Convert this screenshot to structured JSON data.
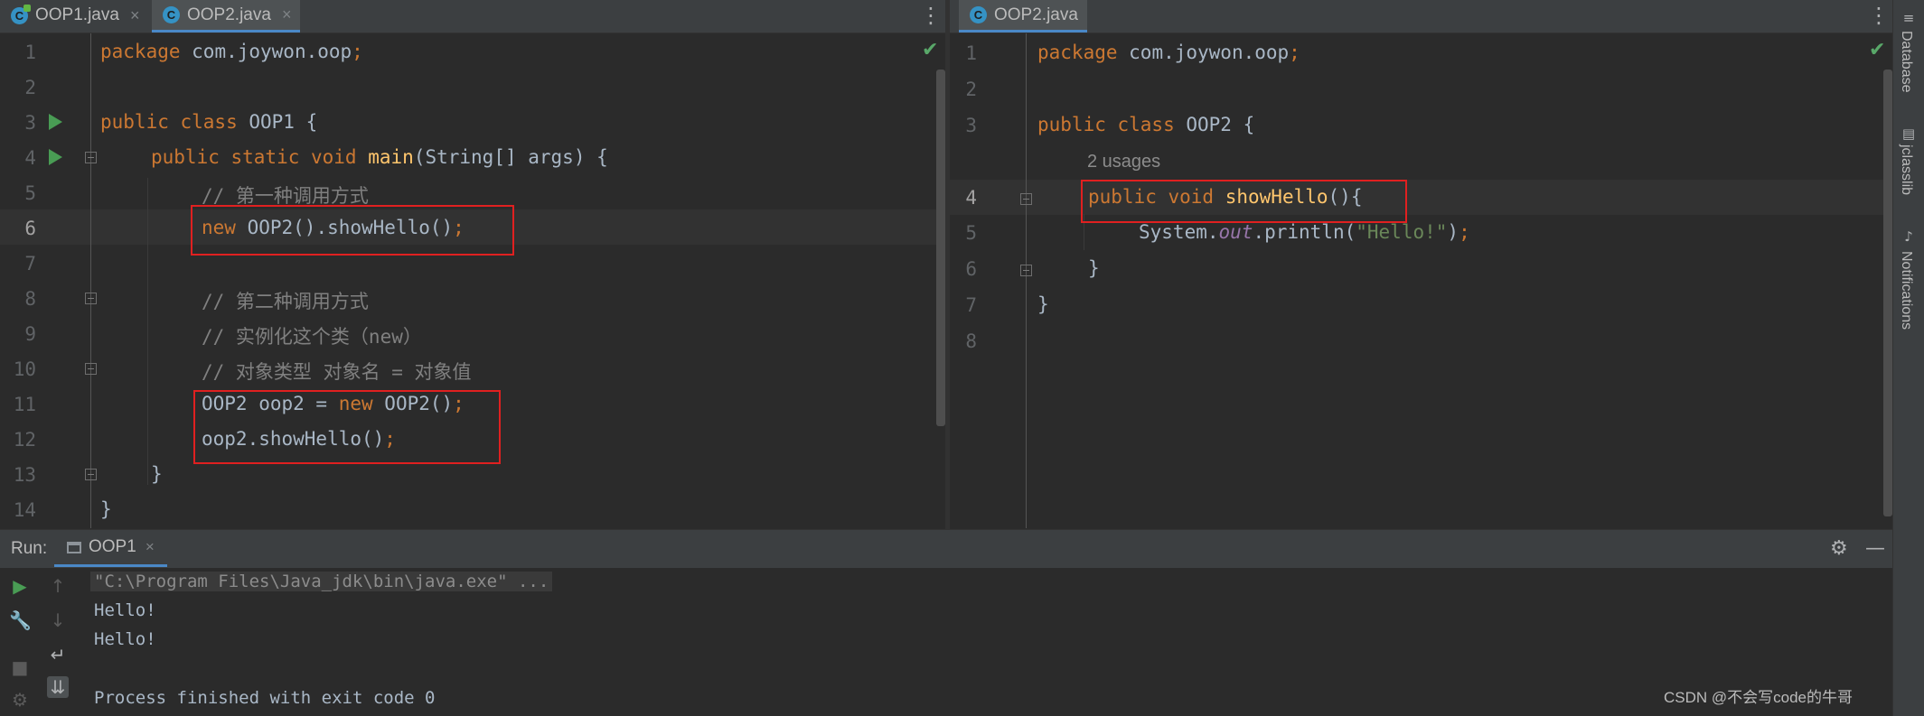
{
  "left_tabs": [
    {
      "label": "OOP1.java",
      "close": "×"
    },
    {
      "label": "OOP2.java",
      "close": "×"
    }
  ],
  "right_tabs": [
    {
      "label": "OOP2.java"
    }
  ],
  "icons": {
    "class_icon_letter": "C",
    "kebab": "⋮",
    "check": "✔",
    "gear": "⚙",
    "minimize": "—",
    "run": "▶",
    "wrench": "🔧",
    "up": "↑",
    "down": "↓",
    "wrap": "↵",
    "stop": "■",
    "scroll": "⇊"
  },
  "left_editor": {
    "line_numbers": [
      "1",
      "2",
      "3",
      "4",
      "5",
      "6",
      "7",
      "8",
      "9",
      "10",
      "11",
      "12",
      "13",
      "14"
    ],
    "lines": {
      "l1_a": "package",
      "l1_b": " com.joywon.oop",
      "l1_c": ";",
      "l3_a": "public class",
      "l3_b": " OOP1 {",
      "l4_a": "public static void",
      "l4_b": "main",
      "l4_c": "(String[] args) {",
      "l5": "// 第一种调用方式",
      "l6_a": "new",
      "l6_b": " OOP2().showHello()",
      "l6_c": ";",
      "l8": "// 第二种调用方式",
      "l9": "// 实例化这个类（new）",
      "l10": "// 对象类型 对象名 = 对象值",
      "l11_a": "OOP2 oop2 = ",
      "l11_b": "new",
      "l11_c": " OOP2()",
      "l11_d": ";",
      "l12_a": "oop2.showHello()",
      "l12_b": ";",
      "l13": "}",
      "l14": "}"
    }
  },
  "right_editor": {
    "line_numbers": [
      "1",
      "2",
      "3",
      "4",
      "5",
      "6",
      "7",
      "8"
    ],
    "usages_hint": "2 usages",
    "lines": {
      "l1_a": "package",
      "l1_b": " com.joywon.oop",
      "l1_c": ";",
      "l3_a": "public class",
      "l3_b": " OOP2 {",
      "l4_a": "public void",
      "l4_b": "showHello",
      "l4_c": "(){",
      "l5_a": "System.",
      "l5_b": "out",
      "l5_c": ".println(",
      "l5_d": "\"Hello!\"",
      "l5_e": ")",
      "l5_f": ";",
      "l6": "}",
      "l7": "}"
    }
  },
  "tool_strip": {
    "database": "Database",
    "jclasslib": "jclasslib",
    "notifications": "Notifications"
  },
  "run_panel": {
    "label": "Run:",
    "tab": "OOP1",
    "tab_close": "×",
    "output": [
      "\"C:\\Program Files\\Java_jdk\\bin\\java.exe\" ...",
      "Hello!",
      "Hello!",
      "",
      "Process finished with exit code 0"
    ]
  },
  "watermark": "CSDN @不会写code的牛哥",
  "colors": {
    "background": "#2b2b2b",
    "keyword": "#cc7832",
    "function": "#ffc66d",
    "comment": "#808080",
    "string": "#6a8759",
    "highlight_box": "#e02020",
    "accent": "#4a88c7"
  }
}
